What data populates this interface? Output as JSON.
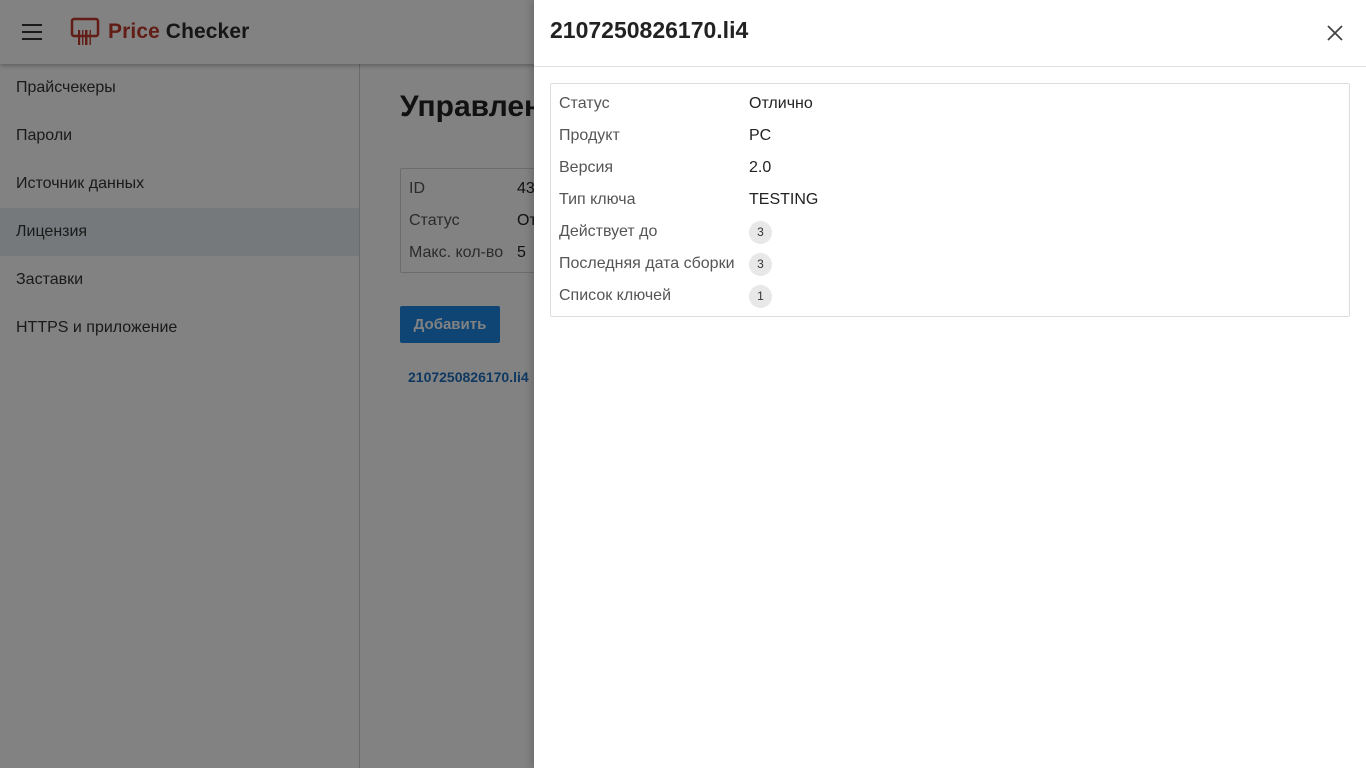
{
  "app": {
    "brand_part1": "Price",
    "brand_part2": " Checker"
  },
  "sidebar": {
    "items": [
      {
        "label": "Прайсчекеры",
        "active": false
      },
      {
        "label": "Пароли",
        "active": false
      },
      {
        "label": "Источник данных",
        "active": false
      },
      {
        "label": "Лицензия",
        "active": true
      },
      {
        "label": "Заставки",
        "active": false
      },
      {
        "label": "HTTPS и приложение",
        "active": false
      }
    ]
  },
  "main": {
    "title": "Управлен",
    "info": {
      "id_label": "ID",
      "id_value": "43",
      "status_label": "Статус",
      "status_value": "От",
      "max_label": "Макс. кол-во",
      "max_value": "5"
    },
    "add_button": "Добавить",
    "file_link": "2107250826170.li4"
  },
  "drawer": {
    "title": "2107250826170.li4",
    "rows": {
      "status": {
        "label": "Статус",
        "value": "Отлично"
      },
      "product": {
        "label": "Продукт",
        "value": "PC"
      },
      "version": {
        "label": "Версия",
        "value": "2.0"
      },
      "key_type": {
        "label": "Тип ключа",
        "value": "TESTING"
      },
      "valid_until": {
        "label": "Действует до",
        "value": "3"
      },
      "last_build": {
        "label": "Последняя дата сборки",
        "value": "3"
      },
      "key_list": {
        "label": "Список ключей",
        "value": "1"
      }
    }
  },
  "colors": {
    "brand_red": "#c0392b",
    "primary_blue": "#1e88e5",
    "active_nav_bg": "#e8edf1"
  }
}
